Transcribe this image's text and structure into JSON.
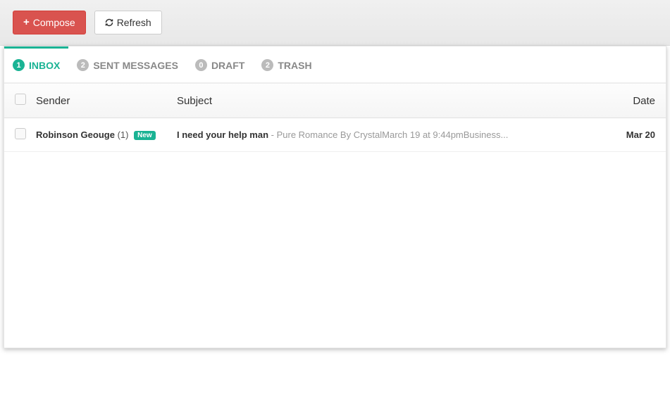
{
  "toolbar": {
    "compose_label": "Compose",
    "refresh_label": "Refresh"
  },
  "tabs": [
    {
      "count": "1",
      "label": "INBOX"
    },
    {
      "count": "2",
      "label": "SENT MESSAGES"
    },
    {
      "count": "0",
      "label": "DRAFT"
    },
    {
      "count": "2",
      "label": "TRASH"
    }
  ],
  "headers": {
    "sender": "Sender",
    "subject": "Subject",
    "date": "Date"
  },
  "rows": [
    {
      "sender": "Robinson Geouge",
      "count": "(1)",
      "badge": "New",
      "subject": "I need your help man",
      "sep": " - ",
      "preview": "Pure Romance By CrystalMarch 19 at 9:44pmBusiness...",
      "date": "Mar 20"
    }
  ]
}
